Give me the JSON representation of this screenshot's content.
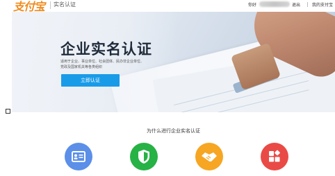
{
  "header": {
    "logo_text": "支付宝",
    "page_label": "实名认证",
    "greeting": "你好",
    "logout": "退出",
    "my_account": "我的支付宝"
  },
  "hero": {
    "title": "企业实名认证",
    "desc_line1": "适用于企业、事业单位、社会团体、民办非企业单位、",
    "desc_line2": "党政及国家机关等各类组织",
    "cta_label": "立即认证"
  },
  "features": {
    "heading": "为什么进行企业实名认证",
    "icons": [
      "id-card-icon",
      "shield-icon",
      "handshake-icon",
      "apps-icon"
    ],
    "colors": [
      "#5b8fe8",
      "#27b245",
      "#f6a623",
      "#ea4a45"
    ]
  }
}
